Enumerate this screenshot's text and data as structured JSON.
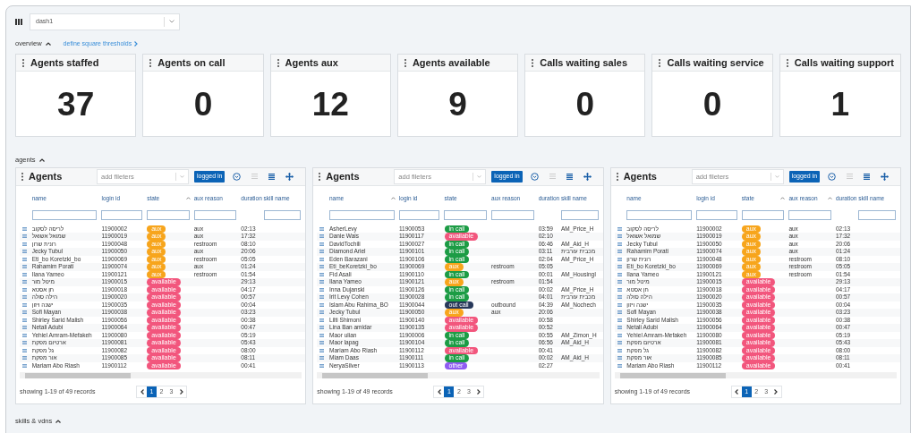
{
  "dashboard_select": {
    "value": "dash1"
  },
  "overview": {
    "label": "overview",
    "expanded": true,
    "link": "define square thresholds"
  },
  "cards": [
    {
      "title": "Agents staffed",
      "value": "37"
    },
    {
      "title": "Agents on call",
      "value": "0"
    },
    {
      "title": "Agents aux",
      "value": "12"
    },
    {
      "title": "Agents available",
      "value": "9"
    },
    {
      "title": "Calls waiting sales",
      "value": "0"
    },
    {
      "title": "Calls waiting service",
      "value": "0"
    },
    {
      "title": "Calls waiting support",
      "value": "1"
    }
  ],
  "agents_section": {
    "label": "agents",
    "expanded": true
  },
  "panels": [
    {
      "title": "Agents",
      "filter_placeholder": "add fileters",
      "button": "logged in",
      "columns": [
        {
          "label": "name",
          "sorted": false
        },
        {
          "label": "login id",
          "sorted": false
        },
        {
          "label": "state",
          "sorted": true
        },
        {
          "label": "aux reason",
          "sorted": false
        },
        {
          "label": "duration",
          "sorted": false
        },
        {
          "label": "skill name",
          "sorted": false
        }
      ],
      "rows": [
        {
          "name": "לריסה לסקוב",
          "login_id": "11900002",
          "state": {
            "label": "aux",
            "kind": "aux"
          },
          "aux_reason": "aux",
          "duration": "02:13"
        },
        {
          "name": "שמואל אשואל",
          "login_id": "11900019",
          "state": {
            "label": "aux",
            "kind": "aux"
          },
          "aux_reason": "aux",
          "duration": "17:32"
        },
        {
          "name": "רונית שרון",
          "login_id": "11900048",
          "state": {
            "label": "aux",
            "kind": "aux"
          },
          "aux_reason": "restroom",
          "duration": "08:10"
        },
        {
          "name": "Jecky Tubul",
          "login_id": "11900050",
          "state": {
            "label": "aux",
            "kind": "aux"
          },
          "aux_reason": "aux",
          "duration": "20:06"
        },
        {
          "name": "Eti_bo Koretzki_bo",
          "login_id": "11900069",
          "state": {
            "label": "aux",
            "kind": "aux"
          },
          "aux_reason": "restroom",
          "duration": "05:05"
        },
        {
          "name": "Rahamim Porati",
          "login_id": "11900074",
          "state": {
            "label": "aux",
            "kind": "aux"
          },
          "aux_reason": "aux",
          "duration": "01:24"
        },
        {
          "name": "Ilana Yameo",
          "login_id": "11900121",
          "state": {
            "label": "aux",
            "kind": "aux"
          },
          "aux_reason": "restroom",
          "duration": "01:54"
        },
        {
          "name": "מיטל מור",
          "login_id": "11900015",
          "state": {
            "label": "available",
            "kind": "available"
          },
          "duration": "29:13"
        },
        {
          "name": "חן אסטא",
          "login_id": "11900018",
          "state": {
            "label": "available",
            "kind": "available"
          },
          "duration": "04:17"
        },
        {
          "name": "הילה סולה",
          "login_id": "11900020",
          "state": {
            "label": "available",
            "kind": "available"
          },
          "duration": "00:57"
        },
        {
          "name": "ישנה ויזון",
          "login_id": "11900035",
          "state": {
            "label": "available",
            "kind": "available"
          },
          "duration": "00:04"
        },
        {
          "name": "Sofi Mayan",
          "login_id": "11900038",
          "state": {
            "label": "available",
            "kind": "available"
          },
          "duration": "03:23"
        },
        {
          "name": "Shirley Sarid Malish",
          "login_id": "11900056",
          "state": {
            "label": "available",
            "kind": "available"
          },
          "duration": "00:38"
        },
        {
          "name": "Netali Adubi",
          "login_id": "11900064",
          "state": {
            "label": "available",
            "kind": "available"
          },
          "duration": "00:47"
        },
        {
          "name": "Yehiel Amram-Mefakeh",
          "login_id": "11900080",
          "state": {
            "label": "available",
            "kind": "available"
          },
          "duration": "05:19"
        },
        {
          "name": "ארטיום מפקת",
          "login_id": "11900081",
          "state": {
            "label": "available",
            "kind": "available"
          },
          "duration": "05:43"
        },
        {
          "name": "גל מפקת",
          "login_id": "11900082",
          "state": {
            "label": "available",
            "kind": "available"
          },
          "duration": "08:00"
        },
        {
          "name": "אור מפקת",
          "login_id": "11900085",
          "state": {
            "label": "available",
            "kind": "available"
          },
          "duration": "08:11"
        },
        {
          "name": "Mariam Abo Riash",
          "login_id": "11900112",
          "state": {
            "label": "available",
            "kind": "available"
          },
          "duration": "00:41"
        }
      ],
      "footer": "showing 1-19 of 49 records",
      "pages": [
        {
          "label": "1",
          "selected": true
        },
        {
          "label": "2",
          "selected": false
        },
        {
          "label": "3",
          "selected": false
        }
      ]
    },
    {
      "title": "Agents",
      "filter_placeholder": "add fileters",
      "button": "logged in",
      "columns": [
        {
          "label": "name",
          "sorted": true
        },
        {
          "label": "login id",
          "sorted": false
        },
        {
          "label": "state",
          "sorted": false
        },
        {
          "label": "aux reason",
          "sorted": false
        },
        {
          "label": "duration",
          "sorted": false
        },
        {
          "label": "skill name",
          "sorted": false
        }
      ],
      "rows": [
        {
          "name": "AsherLevy",
          "login_id": "11900053",
          "state": {
            "label": "in call",
            "kind": "in_call"
          },
          "duration": "03:59",
          "skill_name": "AM_Price_H"
        },
        {
          "name": "Danie Wais",
          "login_id": "11900117",
          "state": {
            "label": "available",
            "kind": "available"
          },
          "duration": "02:10"
        },
        {
          "name": "DavidTochili",
          "login_id": "11900027",
          "state": {
            "label": "in call",
            "kind": "in_call"
          },
          "duration": "06:46",
          "skill_name": "AM_Aid_H"
        },
        {
          "name": "Diamond Ariel",
          "login_id": "11900101",
          "state": {
            "label": "in call",
            "kind": "in_call"
          },
          "duration": "03:11",
          "skill_name": "מכבית עורבית"
        },
        {
          "name": "Eden Barazani",
          "login_id": "11900106",
          "state": {
            "label": "in call",
            "kind": "in_call"
          },
          "duration": "02:04",
          "skill_name": "AM_Price_H"
        },
        {
          "name": "Eti_beKoretzki_bo",
          "login_id": "11900069",
          "state": {
            "label": "aux",
            "kind": "aux"
          },
          "aux_reason": "restroom",
          "duration": "05:05"
        },
        {
          "name": "Fid Asali",
          "login_id": "11900110",
          "state": {
            "label": "in call",
            "kind": "in_call"
          },
          "duration": "00:01",
          "skill_name": "AM_HousingI"
        },
        {
          "name": "Ilana Yameo",
          "login_id": "11900121",
          "state": {
            "label": "aux",
            "kind": "aux"
          },
          "aux_reason": "restroom",
          "duration": "01:54"
        },
        {
          "name": "Inna Dujanski",
          "login_id": "11900126",
          "state": {
            "label": "in call",
            "kind": "in_call"
          },
          "duration": "00:02",
          "skill_name": "AM_Price_H"
        },
        {
          "name": "Irit Levy Cohen",
          "login_id": "11900028",
          "state": {
            "label": "in call",
            "kind": "in_call"
          },
          "duration": "04:01",
          "skill_name": "מכבית עורבית"
        },
        {
          "name": "Islam Abu Rahima_BO",
          "login_id": "11900044",
          "state": {
            "label": "out call",
            "kind": "out_call"
          },
          "aux_reason": "outbound",
          "duration": "04:39",
          "skill_name": "AM_Nochech"
        },
        {
          "name": "Jecky Tubul",
          "login_id": "11900050",
          "state": {
            "label": "aux",
            "kind": "aux"
          },
          "aux_reason": "aux",
          "duration": "20:06"
        },
        {
          "name": "Lilti Shimoni",
          "login_id": "11900140",
          "state": {
            "label": "available",
            "kind": "available"
          },
          "duration": "00:58"
        },
        {
          "name": "Lina Ban amidar",
          "login_id": "11900135",
          "state": {
            "label": "available",
            "kind": "available"
          },
          "duration": "00:52"
        },
        {
          "name": "Maor ulian",
          "login_id": "11900006",
          "state": {
            "label": "in call",
            "kind": "in_call"
          },
          "duration": "00:55",
          "skill_name": "AM_Zimon_H"
        },
        {
          "name": "Maor lapag",
          "login_id": "11900104",
          "state": {
            "label": "in call",
            "kind": "in_call"
          },
          "duration": "06:56",
          "skill_name": "AM_Aid_H"
        },
        {
          "name": "Mariam Abo Riash",
          "login_id": "11900112",
          "state": {
            "label": "available",
            "kind": "available"
          },
          "duration": "00:41"
        },
        {
          "name": "Miam Daas",
          "login_id": "11900111",
          "state": {
            "label": "in call",
            "kind": "in_call"
          },
          "duration": "00:02",
          "skill_name": "AM_Aid_H"
        },
        {
          "name": "NeryaSilver",
          "login_id": "11900113",
          "state": {
            "label": "other",
            "kind": "other"
          },
          "duration": "02:27"
        }
      ],
      "footer": "showing 1-19 of 49 records",
      "pages": [
        {
          "label": "1",
          "selected": true
        },
        {
          "label": "2",
          "selected": false
        },
        {
          "label": "3",
          "selected": false
        }
      ]
    },
    {
      "title": "Agents",
      "filter_placeholder": "add fileters",
      "button": "logged in",
      "columns": [
        {
          "label": "name",
          "sorted": false
        },
        {
          "label": "login id",
          "sorted": false
        },
        {
          "label": "state",
          "sorted": true
        },
        {
          "label": "aux reason",
          "sorted": true
        },
        {
          "label": "duration",
          "sorted": false
        },
        {
          "label": "skill name",
          "sorted": false
        }
      ],
      "rows": [
        {
          "name": "לריסה לסקוב",
          "login_id": "11900002",
          "state": {
            "label": "aux",
            "kind": "aux"
          },
          "aux_reason": "aux",
          "duration": "02:13"
        },
        {
          "name": "שמואל אשואל",
          "login_id": "11900019",
          "state": {
            "label": "aux",
            "kind": "aux"
          },
          "aux_reason": "aux",
          "duration": "17:32"
        },
        {
          "name": "Jecky Tubul",
          "login_id": "11900050",
          "state": {
            "label": "aux",
            "kind": "aux"
          },
          "aux_reason": "aux",
          "duration": "20:06"
        },
        {
          "name": "Rahamim Porati",
          "login_id": "11900074",
          "state": {
            "label": "aux",
            "kind": "aux"
          },
          "aux_reason": "aux",
          "duration": "01:24"
        },
        {
          "name": "רונית שרון",
          "login_id": "11900048",
          "state": {
            "label": "aux",
            "kind": "aux"
          },
          "aux_reason": "restroom",
          "duration": "08:10"
        },
        {
          "name": "Eti_bo Koretzki_bo",
          "login_id": "11900069",
          "state": {
            "label": "aux",
            "kind": "aux"
          },
          "aux_reason": "restroom",
          "duration": "05:05"
        },
        {
          "name": "Ilana Yameo",
          "login_id": "11900121",
          "state": {
            "label": "aux",
            "kind": "aux"
          },
          "aux_reason": "restroom",
          "duration": "01:54"
        },
        {
          "name": "מיטל מור",
          "login_id": "11900015",
          "state": {
            "label": "available",
            "kind": "available"
          },
          "duration": "29:13"
        },
        {
          "name": "חן אסטא",
          "login_id": "11900018",
          "state": {
            "label": "available",
            "kind": "available"
          },
          "duration": "04:17"
        },
        {
          "name": "הילה סולה",
          "login_id": "11900020",
          "state": {
            "label": "available",
            "kind": "available"
          },
          "duration": "00:57"
        },
        {
          "name": "ישנה ויזון",
          "login_id": "11900035",
          "state": {
            "label": "available",
            "kind": "available"
          },
          "duration": "00:04"
        },
        {
          "name": "Sofi Mayan",
          "login_id": "11900038",
          "state": {
            "label": "available",
            "kind": "available"
          },
          "duration": "03:23"
        },
        {
          "name": "Shirley Sarid Malish",
          "login_id": "11900056",
          "state": {
            "label": "available",
            "kind": "available"
          },
          "duration": "00:38"
        },
        {
          "name": "Netali Adubi",
          "login_id": "11900064",
          "state": {
            "label": "available",
            "kind": "available"
          },
          "duration": "00:47"
        },
        {
          "name": "Yehiel Amram-Mefakeh",
          "login_id": "11900080",
          "state": {
            "label": "available",
            "kind": "available"
          },
          "duration": "05:19"
        },
        {
          "name": "ארטיום מפקת",
          "login_id": "11900081",
          "state": {
            "label": "available",
            "kind": "available"
          },
          "duration": "05:43"
        },
        {
          "name": "גל מפקת",
          "login_id": "11900082",
          "state": {
            "label": "available",
            "kind": "available"
          },
          "duration": "08:00"
        },
        {
          "name": "אור מפקת",
          "login_id": "11900085",
          "state": {
            "label": "available",
            "kind": "available"
          },
          "duration": "08:11"
        },
        {
          "name": "Mariam Abo Riash",
          "login_id": "11900112",
          "state": {
            "label": "available",
            "kind": "available"
          },
          "duration": "00:41"
        }
      ],
      "footer": "showing 1-19 of 49 records",
      "pages": [
        {
          "label": "1",
          "selected": true
        },
        {
          "label": "2",
          "selected": false
        },
        {
          "label": "3",
          "selected": false
        }
      ]
    }
  ],
  "skills_section": {
    "label": "skills & vdns",
    "expanded": true
  }
}
